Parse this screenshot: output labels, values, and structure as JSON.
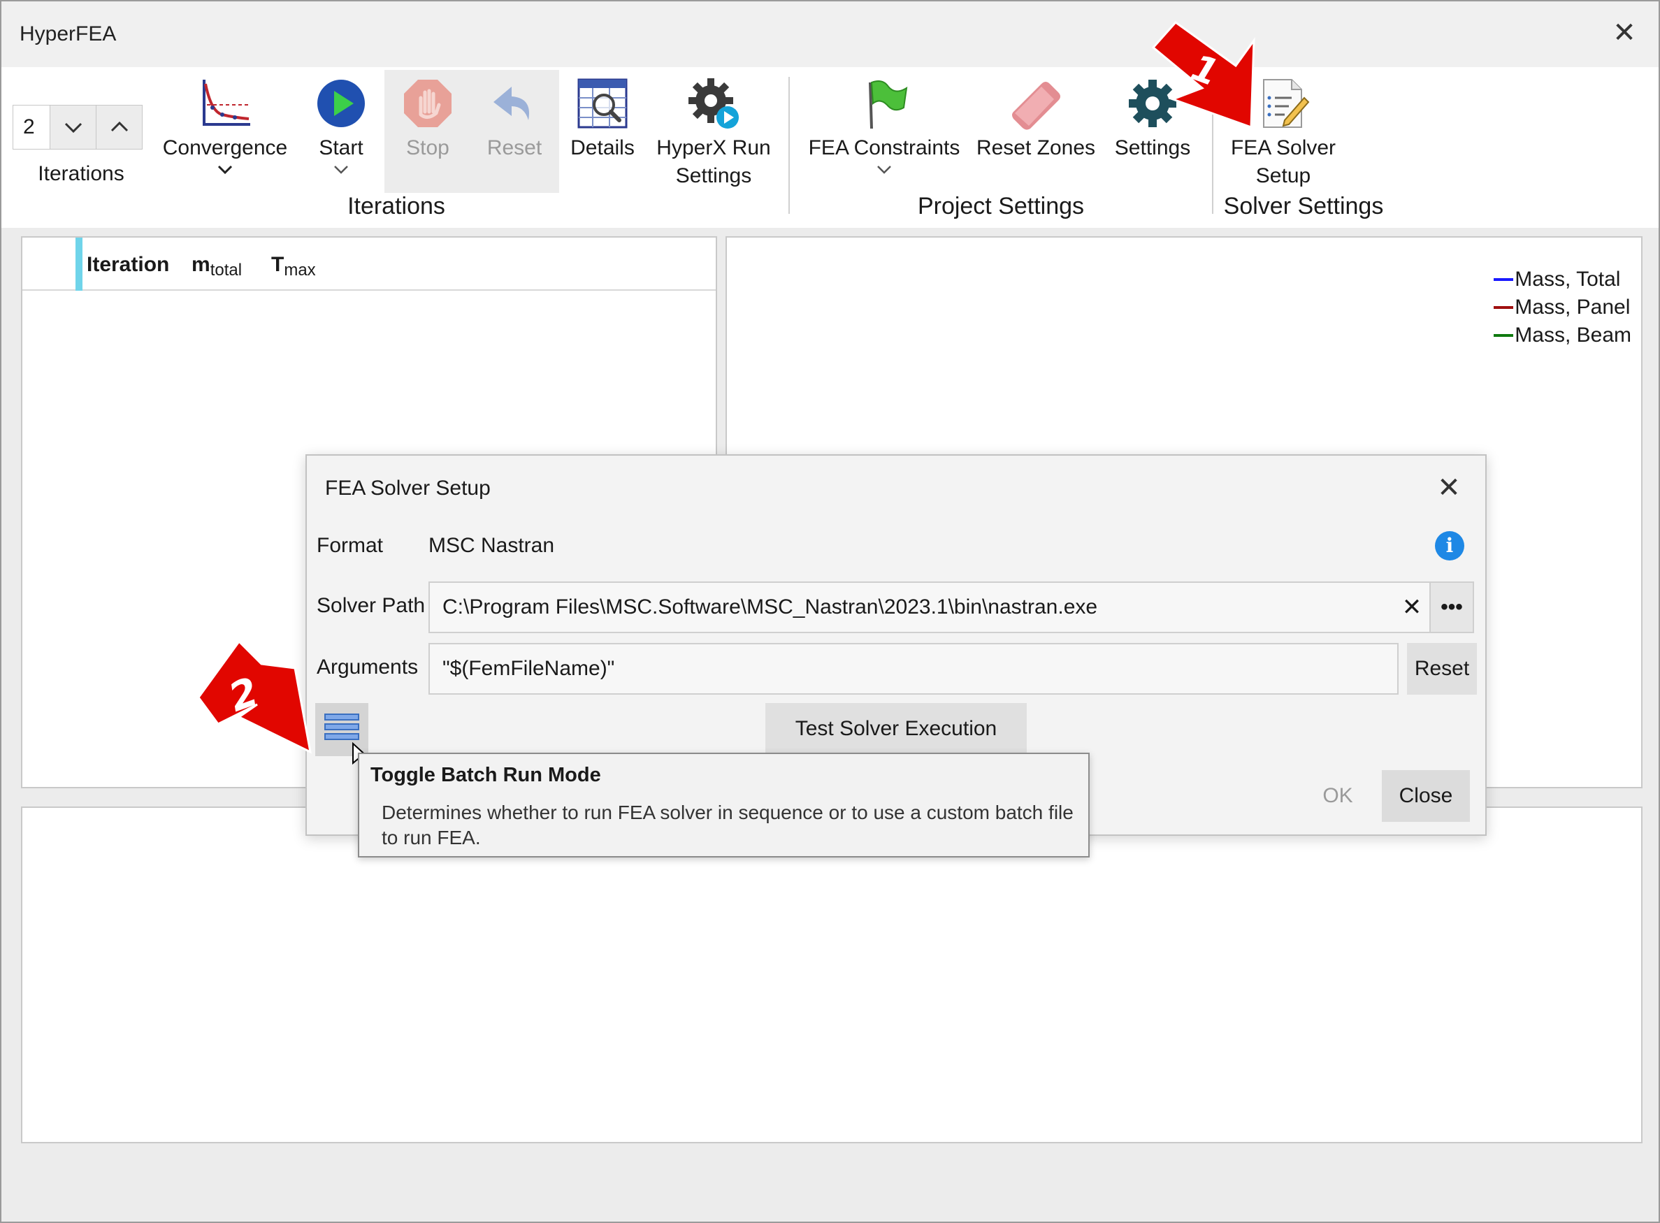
{
  "window": {
    "title": "HyperFEA",
    "close_glyph": "✕"
  },
  "ribbon": {
    "iterations_value": "2",
    "iterations_label": "Iterations",
    "buttons": {
      "convergence": "Convergence",
      "start": "Start",
      "stop": "Stop",
      "reset": "Reset",
      "details": "Details",
      "hyperx_run_settings_line1": "HyperX Run",
      "hyperx_run_settings_line2": "Settings",
      "fea_constraints": "FEA Constraints",
      "reset_zones": "Reset Zones",
      "settings": "Settings",
      "fea_solver_setup_line1": "FEA Solver",
      "fea_solver_setup_line2": "Setup"
    },
    "groups": {
      "iterations": "Iterations",
      "project_settings": "Project Settings",
      "solver_settings": "Solver Settings"
    }
  },
  "table": {
    "columns": [
      {
        "label": "Iteration",
        "sub": ""
      },
      {
        "label": "m",
        "sub": "total"
      },
      {
        "label": "T",
        "sub": "max"
      }
    ]
  },
  "chart_legend": [
    {
      "name": "Mass, Total",
      "color": "#1a1aff"
    },
    {
      "name": "Mass, Panel",
      "color": "#a01010"
    },
    {
      "name": "Mass, Beam",
      "color": "#0f7a0f"
    }
  ],
  "dialog": {
    "title": "FEA Solver Setup",
    "format_label": "Format",
    "format_value": "MSC Nastran",
    "solver_path_label": "Solver Path",
    "solver_path_value": "C:\\Program Files\\MSC.Software\\MSC_Nastran\\2023.1\\bin\\nastran.exe",
    "browse_label": "•••",
    "clear_glyph": "✕",
    "arguments_label": "Arguments",
    "arguments_value": "\"$(FemFileName)\"",
    "reset_label": "Reset",
    "test_label": "Test Solver Execution",
    "ok_label": "OK",
    "close_label": "Close",
    "info_glyph": "i"
  },
  "tooltip": {
    "title": "Toggle Batch Run Mode",
    "body": "Determines whether to run FEA solver in sequence or to use a custom batch file to run FEA."
  },
  "callouts": {
    "one": "1",
    "two": "2"
  }
}
